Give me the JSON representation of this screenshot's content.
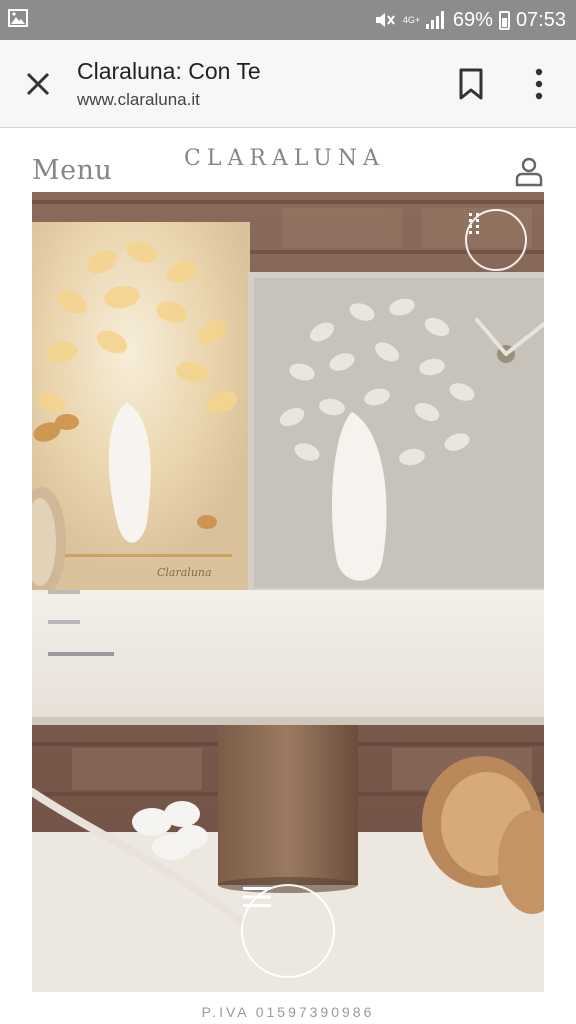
{
  "statusbar": {
    "signal_label": "4G+",
    "battery": "69%",
    "time": "07:53",
    "icons": [
      "gallery-icon",
      "mute-icon",
      "signal-icon",
      "battery-icon"
    ]
  },
  "toolbar": {
    "title": "Claraluna: Con Te",
    "url": "www.claraluna.it",
    "icons": [
      "close-icon",
      "bookmark-icon",
      "more-vert-icon"
    ]
  },
  "site": {
    "menu_label": "Menu",
    "brand": "CLARALUNA",
    "user_icon": "user-icon"
  },
  "hero": {
    "product_signature": "Claraluna",
    "slider_count": 3,
    "slider_active": 3,
    "icons": [
      "grid-icon",
      "hamburger-icon"
    ]
  },
  "footer": {
    "piva": "P.IVA 01597390986"
  },
  "colors": {
    "status_bar": "#8c8c8c",
    "toolbar_bg": "#f7f7f7",
    "brand_text": "#8a8583",
    "footer_text": "#9a9a9a"
  }
}
